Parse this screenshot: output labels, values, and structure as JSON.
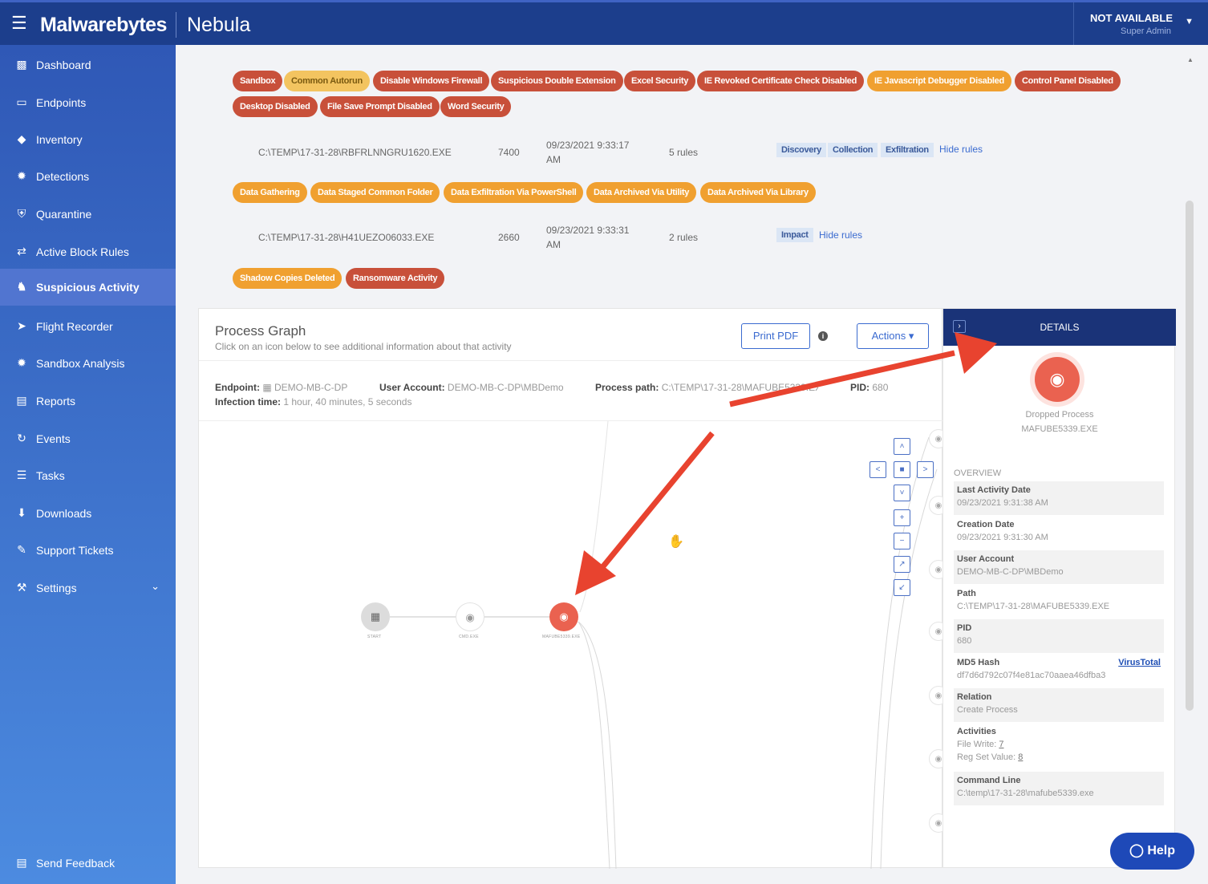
{
  "header": {
    "brand": "Malwarebytes",
    "product": "Nebula",
    "user_status": "NOT AVAILABLE",
    "user_role": "Super Admin"
  },
  "sidebar": {
    "items": [
      {
        "label": "Dashboard",
        "icon": "bar-chart-icon"
      },
      {
        "label": "Endpoints",
        "icon": "monitor-icon"
      },
      {
        "label": "Inventory",
        "icon": "tag-icon"
      },
      {
        "label": "Detections",
        "icon": "bug-icon"
      },
      {
        "label": "Quarantine",
        "icon": "shield-icon"
      },
      {
        "label": "Active Block Rules",
        "icon": "arrows-icon"
      },
      {
        "label": "Suspicious Activity",
        "icon": "user-secret-icon"
      },
      {
        "label": "Flight Recorder",
        "icon": "paper-plane-icon"
      },
      {
        "label": "Sandbox Analysis",
        "icon": "bug-icon"
      },
      {
        "label": "Reports",
        "icon": "document-icon"
      },
      {
        "label": "Events",
        "icon": "history-icon"
      },
      {
        "label": "Tasks",
        "icon": "list-icon"
      },
      {
        "label": "Downloads",
        "icon": "download-icon"
      },
      {
        "label": "Support Tickets",
        "icon": "chat-icon"
      },
      {
        "label": "Settings",
        "icon": "wrench-icon"
      }
    ],
    "feedback": "Send Feedback"
  },
  "tags": {
    "row1": [
      "Sandbox",
      "Common Autorun",
      "Disable Windows Firewall",
      "Suspicious Double Extension",
      "Excel Security",
      "IE Revoked Certificate Check Disabled",
      "IE Javascript Debugger Disabled",
      "Control Panel Disabled"
    ],
    "row2": [
      "Desktop Disabled",
      "File Save Prompt Disabled",
      "Word Security"
    ],
    "row3": [
      "Data Gathering",
      "Data Staged Common Folder",
      "Data Exfiltration Via PowerShell",
      "Data Archived Via Utility",
      "Data Archived Via Library"
    ],
    "row4": [
      "Shadow Copies Deleted",
      "Ransomware Activity"
    ]
  },
  "processes": [
    {
      "path": "C:\\TEMP\\17-31-28\\RBFRLNNGRU1620.EXE",
      "pid": "7400",
      "date1": "09/23/2021 9:33:17",
      "date2": "AM",
      "rules": "5 rules",
      "labels": [
        "Discovery",
        "Collection",
        "Exfiltration"
      ],
      "hide": "Hide rules"
    },
    {
      "path": "C:\\TEMP\\17-31-28\\H41UEZO06033.EXE",
      "pid": "2660",
      "date1": "09/23/2021 9:33:31",
      "date2": "AM",
      "rules": "2 rules",
      "labels": [
        "Impact"
      ],
      "hide": "Hide rules"
    }
  ],
  "graph": {
    "title": "Process Graph",
    "subtitle": "Click on an icon below to see additional information about that activity",
    "print": "Print PDF",
    "actions": "Actions",
    "meta": {
      "endpoint_k": "Endpoint:",
      "endpoint_v": "DEMO-MB-C-DP",
      "user_k": "User Account:",
      "user_v": "DEMO-MB-C-DP\\MBDemo",
      "path_k": "Process path:",
      "path_v": "C:\\TEMP\\17-31-28\\MAFUBE5339.EXE",
      "pid_k": "PID:",
      "pid_v": "680",
      "inf_k": "Infection time:",
      "inf_v": "1 hour, 40 minutes, 5 seconds"
    },
    "nodes": [
      "START",
      "CMD.EXE",
      "MAFUBE5339.EXE"
    ]
  },
  "details": {
    "header": "DETAILS",
    "type": "Dropped Process",
    "name": "MAFUBE5339.EXE",
    "overview": "OVERVIEW",
    "rows": [
      {
        "k": "Last Activity Date",
        "v": "09/23/2021 9:31:38 AM"
      },
      {
        "k": "Creation Date",
        "v": "09/23/2021 9:31:30 AM"
      },
      {
        "k": "User Account",
        "v": "DEMO-MB-C-DP\\MBDemo"
      },
      {
        "k": "Path",
        "v": "C:\\TEMP\\17-31-28\\MAFUBE5339.EXE"
      },
      {
        "k": "PID",
        "v": "680"
      },
      {
        "k": "MD5 Hash",
        "v": "df7d6d792c07f4e81ac70aaea46dfba3"
      },
      {
        "k": "Relation",
        "v": "Create Process"
      }
    ],
    "virustotal": "VirusTotal",
    "activities_k": "Activities",
    "file_write_k": "File Write:",
    "file_write_v": "7",
    "reg_set_k": "Reg Set Value:",
    "reg_set_v": "8",
    "cmd_k": "Command Line",
    "cmd_v": "C:\\temp\\17-31-28\\mafube5339.exe"
  },
  "help": "Help",
  "colors": {
    "brand_blue": "#1c3e8c",
    "tag_red": "#c8503a",
    "tag_orange": "#f0a030",
    "node_red": "#ea6250",
    "arrow": "#e8432f"
  }
}
